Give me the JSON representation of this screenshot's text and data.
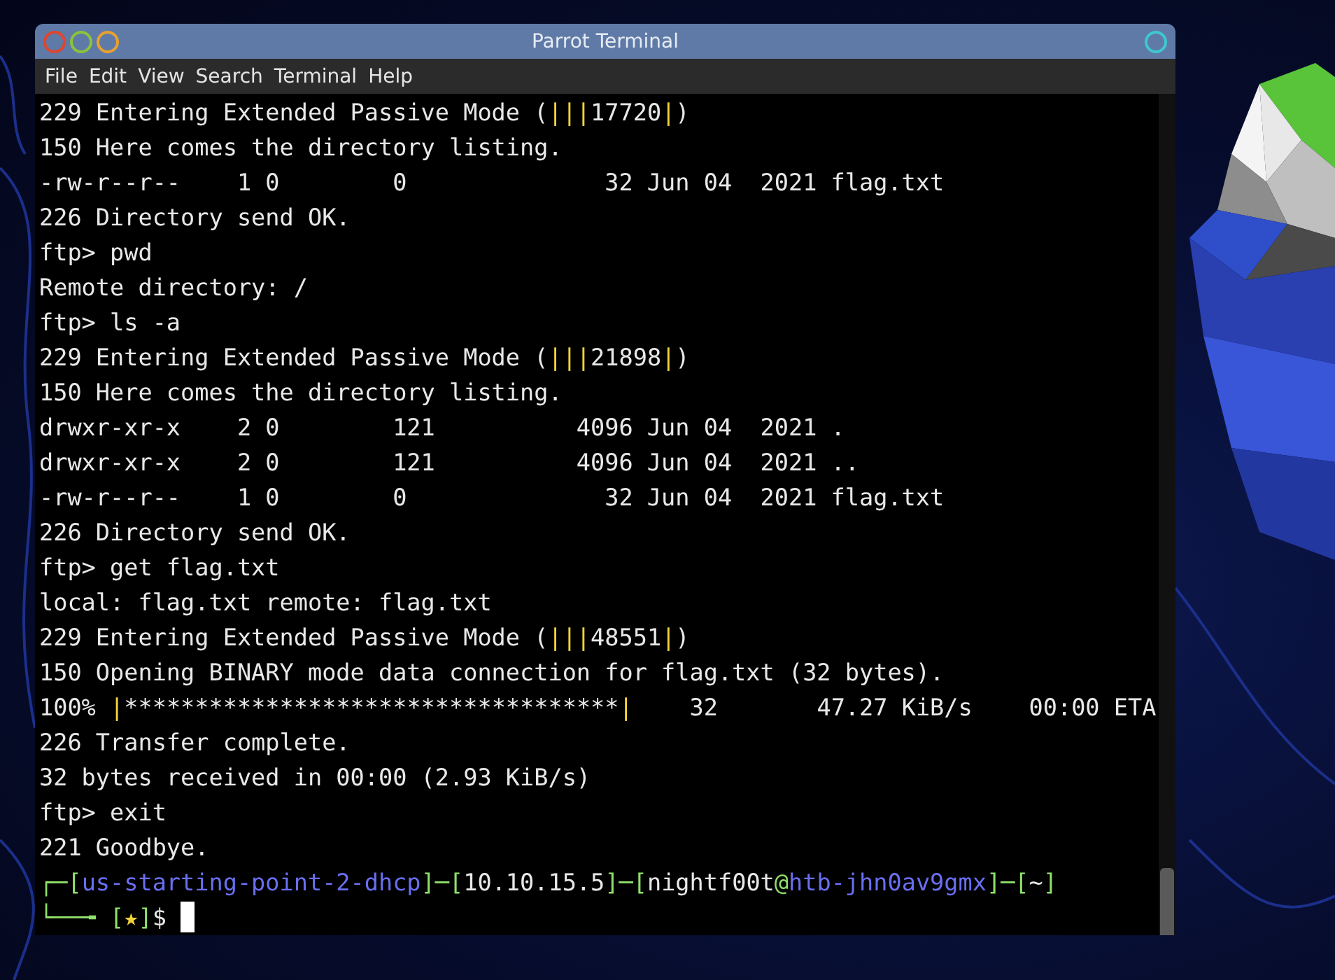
{
  "window": {
    "title": "Parrot Terminal"
  },
  "menu": [
    "File",
    "Edit",
    "View",
    "Search",
    "Terminal",
    "Help"
  ],
  "lines": [
    {
      "segments": [
        {
          "text": "229 Entering Extended Passive Mode (",
          "kind": "plain"
        },
        {
          "text": "|||",
          "kind": "pipe"
        },
        {
          "text": "17720",
          "kind": "plain"
        },
        {
          "text": "|",
          "kind": "pipe"
        },
        {
          "text": ")",
          "kind": "plain"
        }
      ]
    },
    {
      "segments": [
        {
          "text": "150 Here comes the directory listing.",
          "kind": "plain"
        }
      ]
    },
    {
      "segments": [
        {
          "text": "-rw-r--r--    1 0        0              32 Jun 04  2021 flag.txt",
          "kind": "plain"
        }
      ]
    },
    {
      "segments": [
        {
          "text": "226 Directory send OK.",
          "kind": "plain"
        }
      ]
    },
    {
      "segments": [
        {
          "text": "ftp> pwd",
          "kind": "plain"
        }
      ]
    },
    {
      "segments": [
        {
          "text": "Remote directory: /",
          "kind": "plain"
        }
      ]
    },
    {
      "segments": [
        {
          "text": "ftp> ls -a",
          "kind": "plain"
        }
      ]
    },
    {
      "segments": [
        {
          "text": "229 Entering Extended Passive Mode (",
          "kind": "plain"
        },
        {
          "text": "|||",
          "kind": "pipe"
        },
        {
          "text": "21898",
          "kind": "plain"
        },
        {
          "text": "|",
          "kind": "pipe"
        },
        {
          "text": ")",
          "kind": "plain"
        }
      ]
    },
    {
      "segments": [
        {
          "text": "150 Here comes the directory listing.",
          "kind": "plain"
        }
      ]
    },
    {
      "segments": [
        {
          "text": "drwxr-xr-x    2 0        121          4096 Jun 04  2021 .",
          "kind": "plain"
        }
      ]
    },
    {
      "segments": [
        {
          "text": "drwxr-xr-x    2 0        121          4096 Jun 04  2021 ..",
          "kind": "plain"
        }
      ]
    },
    {
      "segments": [
        {
          "text": "-rw-r--r--    1 0        0              32 Jun 04  2021 flag.txt",
          "kind": "plain"
        }
      ]
    },
    {
      "segments": [
        {
          "text": "226 Directory send OK.",
          "kind": "plain"
        }
      ]
    },
    {
      "segments": [
        {
          "text": "ftp> get flag.txt",
          "kind": "plain"
        }
      ]
    },
    {
      "segments": [
        {
          "text": "local: flag.txt remote: flag.txt",
          "kind": "plain"
        }
      ]
    },
    {
      "segments": [
        {
          "text": "229 Entering Extended Passive Mode (",
          "kind": "plain"
        },
        {
          "text": "|||",
          "kind": "pipe"
        },
        {
          "text": "48551",
          "kind": "plain"
        },
        {
          "text": "|",
          "kind": "pipe"
        },
        {
          "text": ")",
          "kind": "plain"
        }
      ]
    },
    {
      "segments": [
        {
          "text": "150 Opening BINARY mode data connection for flag.txt (32 bytes).",
          "kind": "plain"
        }
      ]
    },
    {
      "segments": [
        {
          "text": "100% ",
          "kind": "plain"
        },
        {
          "text": "|",
          "kind": "pipe"
        },
        {
          "text": "***********************************",
          "kind": "plain"
        },
        {
          "text": "|",
          "kind": "pipe"
        },
        {
          "text": "    32       47.27 KiB/s    00:00 ETA",
          "kind": "plain"
        }
      ]
    },
    {
      "segments": [
        {
          "text": "226 Transfer complete.",
          "kind": "plain"
        }
      ]
    },
    {
      "segments": [
        {
          "text": "32 bytes received in 00:00 (2.93 KiB/s)",
          "kind": "plain"
        }
      ]
    },
    {
      "segments": [
        {
          "text": "ftp> exit",
          "kind": "plain"
        }
      ]
    },
    {
      "segments": [
        {
          "text": "221 Goodbye.",
          "kind": "plain"
        }
      ]
    },
    {
      "segments": [
        {
          "text": "┌─[",
          "kind": "frame"
        },
        {
          "text": "us-starting-point-2-dhcp",
          "kind": "host"
        },
        {
          "text": "]─[",
          "kind": "frame"
        },
        {
          "text": "10.10.15.5",
          "kind": "plain"
        },
        {
          "text": "]─[",
          "kind": "frame"
        },
        {
          "text": "nightf00t",
          "kind": "plain"
        },
        {
          "text": "@",
          "kind": "frame"
        },
        {
          "text": "htb-jhn0av9gmx",
          "kind": "host"
        },
        {
          "text": "]─[",
          "kind": "frame"
        },
        {
          "text": "~",
          "kind": "plain"
        },
        {
          "text": "]",
          "kind": "frame"
        }
      ]
    },
    {
      "segments": [
        {
          "text": "└──╼ [",
          "kind": "frame"
        },
        {
          "text": "★",
          "kind": "pipe"
        },
        {
          "text": "]",
          "kind": "frame"
        },
        {
          "text": "$",
          "kind": "plain"
        }
      ],
      "cursor": true
    }
  ]
}
